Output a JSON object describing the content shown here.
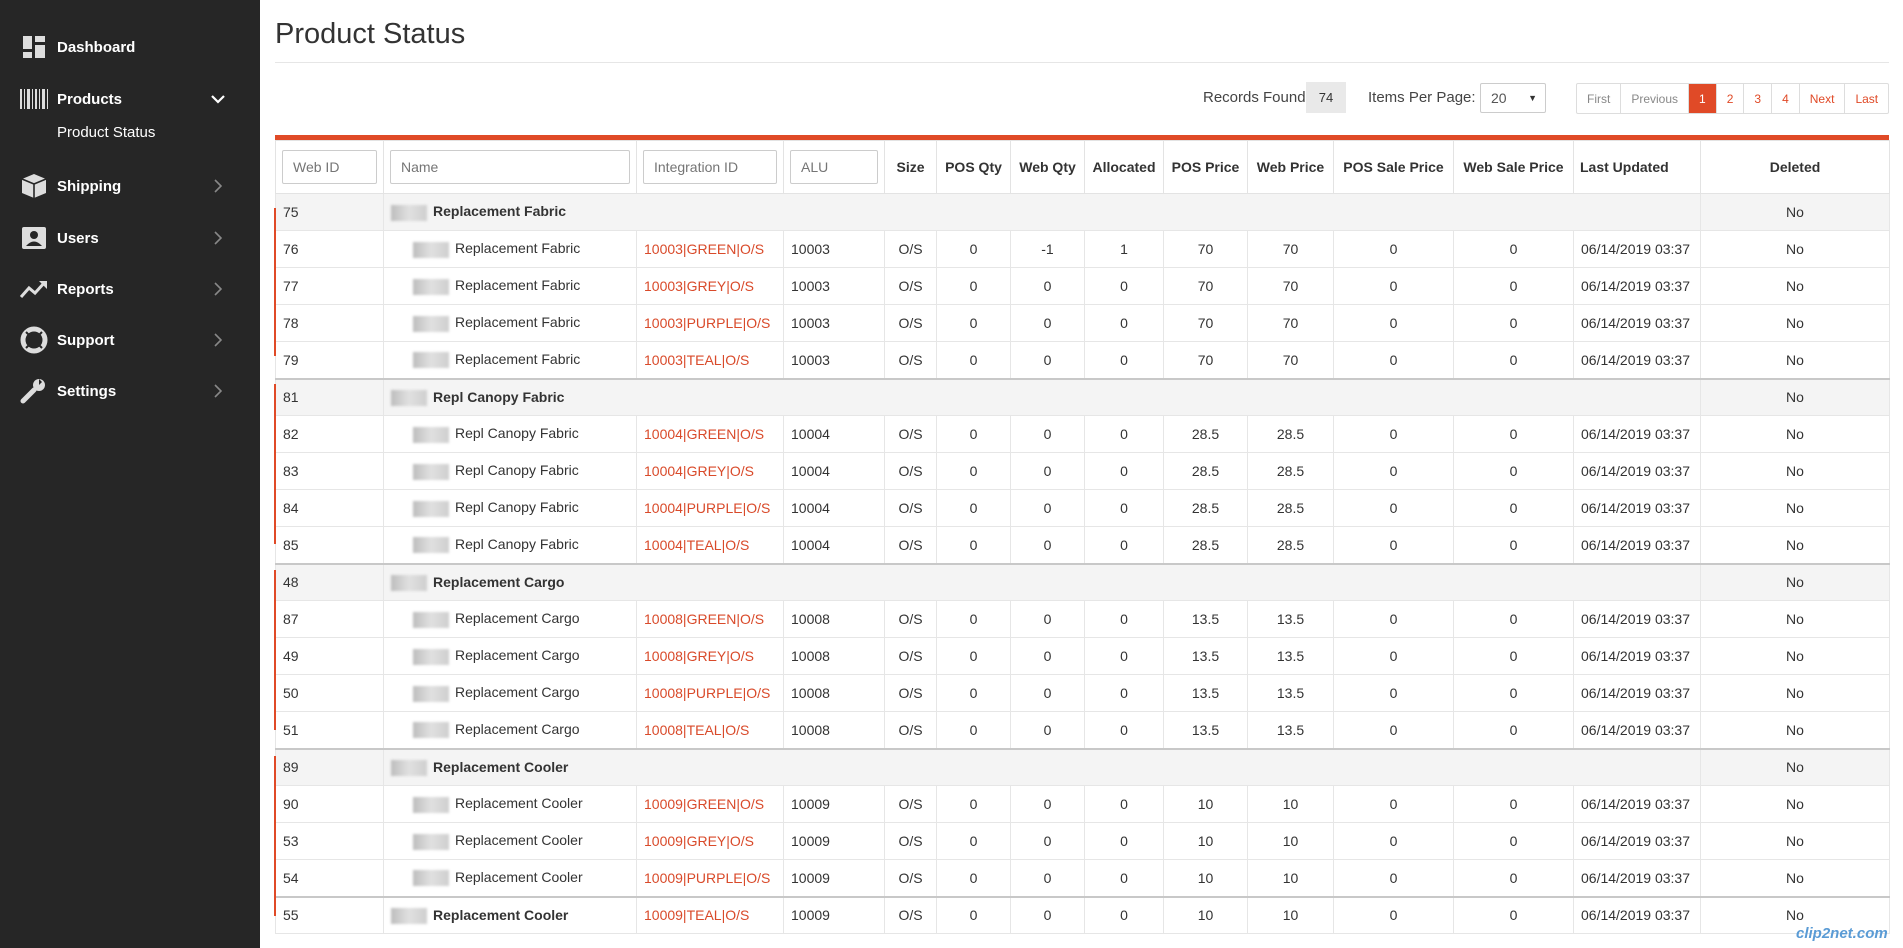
{
  "sidebar": {
    "items": [
      {
        "label": "Dashboard",
        "icon": "dashboard-icon"
      },
      {
        "label": "Products",
        "icon": "barcode-icon"
      },
      {
        "label": "Shipping",
        "icon": "box-icon"
      },
      {
        "label": "Users",
        "icon": "user-card-icon"
      },
      {
        "label": "Reports",
        "icon": "trend-icon"
      },
      {
        "label": "Support",
        "icon": "lifebuoy-icon"
      },
      {
        "label": "Settings",
        "icon": "wrench-icon"
      }
    ],
    "sub_item": "Product Status"
  },
  "page_title": "Product Status",
  "toolbar": {
    "records_label": "Records Found:",
    "records_count": "74",
    "ipp_label": "Items Per Page:",
    "ipp_value": "20",
    "pager": [
      "First",
      "Previous",
      "1",
      "2",
      "3",
      "4",
      "Next",
      "Last"
    ],
    "active_page": "1"
  },
  "table": {
    "filters": {
      "web_id": "Web ID",
      "name": "Name",
      "integration_id": "Integration ID",
      "alu": "ALU"
    },
    "headers": {
      "size": "Size",
      "pos_qty": "POS Qty",
      "web_qty": "Web Qty",
      "allocated": "Allocated",
      "pos_price": "POS Price",
      "web_price": "Web Price",
      "pos_sale_price": "POS Sale Price",
      "web_sale_price": "Web Sale Price",
      "last_updated": "Last Updated",
      "deleted": "Deleted"
    },
    "rows": [
      {
        "type": "parent",
        "id": "75",
        "name": "Replacement Fabric",
        "deleted": "No"
      },
      {
        "type": "child",
        "id": "76",
        "name": "Replacement Fabric",
        "integ": "10003|GREEN|O/S",
        "alu": "10003",
        "size": "O/S",
        "pos_qty": "0",
        "web_qty": "-1",
        "alloc": "1",
        "pos_price": "70",
        "web_price": "70",
        "pos_sale": "0",
        "web_sale": "0",
        "updated": "06/14/2019 03:37",
        "deleted": "No"
      },
      {
        "type": "child",
        "id": "77",
        "name": "Replacement Fabric",
        "integ": "10003|GREY|O/S",
        "alu": "10003",
        "size": "O/S",
        "pos_qty": "0",
        "web_qty": "0",
        "alloc": "0",
        "pos_price": "70",
        "web_price": "70",
        "pos_sale": "0",
        "web_sale": "0",
        "updated": "06/14/2019 03:37",
        "deleted": "No"
      },
      {
        "type": "child",
        "id": "78",
        "name": "Replacement Fabric",
        "integ": "10003|PURPLE|O/S",
        "alu": "10003",
        "size": "O/S",
        "pos_qty": "0",
        "web_qty": "0",
        "alloc": "0",
        "pos_price": "70",
        "web_price": "70",
        "pos_sale": "0",
        "web_sale": "0",
        "updated": "06/14/2019 03:37",
        "deleted": "No"
      },
      {
        "type": "child",
        "id": "79",
        "name": "Replacement Fabric",
        "integ": "10003|TEAL|O/S",
        "alu": "10003",
        "size": "O/S",
        "pos_qty": "0",
        "web_qty": "0",
        "alloc": "0",
        "pos_price": "70",
        "web_price": "70",
        "pos_sale": "0",
        "web_sale": "0",
        "updated": "06/14/2019 03:37",
        "deleted": "No"
      },
      {
        "type": "parent",
        "id": "81",
        "name": "Repl Canopy Fabric",
        "deleted": "No"
      },
      {
        "type": "child",
        "id": "82",
        "name": "Repl Canopy Fabric",
        "integ": "10004|GREEN|O/S",
        "alu": "10004",
        "size": "O/S",
        "pos_qty": "0",
        "web_qty": "0",
        "alloc": "0",
        "pos_price": "28.5",
        "web_price": "28.5",
        "pos_sale": "0",
        "web_sale": "0",
        "updated": "06/14/2019 03:37",
        "deleted": "No"
      },
      {
        "type": "child",
        "id": "83",
        "name": "Repl Canopy Fabric",
        "integ": "10004|GREY|O/S",
        "alu": "10004",
        "size": "O/S",
        "pos_qty": "0",
        "web_qty": "0",
        "alloc": "0",
        "pos_price": "28.5",
        "web_price": "28.5",
        "pos_sale": "0",
        "web_sale": "0",
        "updated": "06/14/2019 03:37",
        "deleted": "No"
      },
      {
        "type": "child",
        "id": "84",
        "name": "Repl Canopy Fabric",
        "integ": "10004|PURPLE|O/S",
        "alu": "10004",
        "size": "O/S",
        "pos_qty": "0",
        "web_qty": "0",
        "alloc": "0",
        "pos_price": "28.5",
        "web_price": "28.5",
        "pos_sale": "0",
        "web_sale": "0",
        "updated": "06/14/2019 03:37",
        "deleted": "No"
      },
      {
        "type": "child",
        "id": "85",
        "name": "Repl Canopy Fabric",
        "integ": "10004|TEAL|O/S",
        "alu": "10004",
        "size": "O/S",
        "pos_qty": "0",
        "web_qty": "0",
        "alloc": "0",
        "pos_price": "28.5",
        "web_price": "28.5",
        "pos_sale": "0",
        "web_sale": "0",
        "updated": "06/14/2019 03:37",
        "deleted": "No"
      },
      {
        "type": "parent",
        "id": "48",
        "name": "Replacement Cargo",
        "deleted": "No"
      },
      {
        "type": "child",
        "id": "87",
        "name": "Replacement Cargo",
        "integ": "10008|GREEN|O/S",
        "alu": "10008",
        "size": "O/S",
        "pos_qty": "0",
        "web_qty": "0",
        "alloc": "0",
        "pos_price": "13.5",
        "web_price": "13.5",
        "pos_sale": "0",
        "web_sale": "0",
        "updated": "06/14/2019 03:37",
        "deleted": "No"
      },
      {
        "type": "child",
        "id": "49",
        "name": "Replacement Cargo",
        "integ": "10008|GREY|O/S",
        "alu": "10008",
        "size": "O/S",
        "pos_qty": "0",
        "web_qty": "0",
        "alloc": "0",
        "pos_price": "13.5",
        "web_price": "13.5",
        "pos_sale": "0",
        "web_sale": "0",
        "updated": "06/14/2019 03:37",
        "deleted": "No"
      },
      {
        "type": "child",
        "id": "50",
        "name": "Replacement Cargo",
        "integ": "10008|PURPLE|O/S",
        "alu": "10008",
        "size": "O/S",
        "pos_qty": "0",
        "web_qty": "0",
        "alloc": "0",
        "pos_price": "13.5",
        "web_price": "13.5",
        "pos_sale": "0",
        "web_sale": "0",
        "updated": "06/14/2019 03:37",
        "deleted": "No"
      },
      {
        "type": "child",
        "id": "51",
        "name": "Replacement Cargo",
        "integ": "10008|TEAL|O/S",
        "alu": "10008",
        "size": "O/S",
        "pos_qty": "0",
        "web_qty": "0",
        "alloc": "0",
        "pos_price": "13.5",
        "web_price": "13.5",
        "pos_sale": "0",
        "web_sale": "0",
        "updated": "06/14/2019 03:37",
        "deleted": "No"
      },
      {
        "type": "parent",
        "id": "89",
        "name": "Replacement Cooler",
        "deleted": "No"
      },
      {
        "type": "child",
        "id": "90",
        "name": "Replacement Cooler",
        "integ": "10009|GREEN|O/S",
        "alu": "10009",
        "size": "O/S",
        "pos_qty": "0",
        "web_qty": "0",
        "alloc": "0",
        "pos_price": "10",
        "web_price": "10",
        "pos_sale": "0",
        "web_sale": "0",
        "updated": "06/14/2019 03:37",
        "deleted": "No"
      },
      {
        "type": "child",
        "id": "53",
        "name": "Replacement Cooler",
        "integ": "10009|GREY|O/S",
        "alu": "10009",
        "size": "O/S",
        "pos_qty": "0",
        "web_qty": "0",
        "alloc": "0",
        "pos_price": "10",
        "web_price": "10",
        "pos_sale": "0",
        "web_sale": "0",
        "updated": "06/14/2019 03:37",
        "deleted": "No"
      },
      {
        "type": "child",
        "id": "54",
        "name": "Replacement Cooler",
        "integ": "10009|PURPLE|O/S",
        "alu": "10009",
        "size": "O/S",
        "pos_qty": "0",
        "web_qty": "0",
        "alloc": "0",
        "pos_price": "10",
        "web_price": "10",
        "pos_sale": "0",
        "web_sale": "0",
        "updated": "06/14/2019 03:37",
        "deleted": "No"
      },
      {
        "type": "single",
        "id": "55",
        "name": "Replacement Cooler",
        "integ": "10009|TEAL|O/S",
        "alu": "10009",
        "size": "O/S",
        "pos_qty": "0",
        "web_qty": "0",
        "alloc": "0",
        "pos_price": "10",
        "web_price": "10",
        "pos_sale": "0",
        "web_sale": "0",
        "updated": "06/14/2019 03:37",
        "deleted": "No"
      }
    ]
  },
  "watermark": "clip2net.com",
  "colors": {
    "accent": "#e04a27",
    "sidebar_bg": "#262626"
  }
}
